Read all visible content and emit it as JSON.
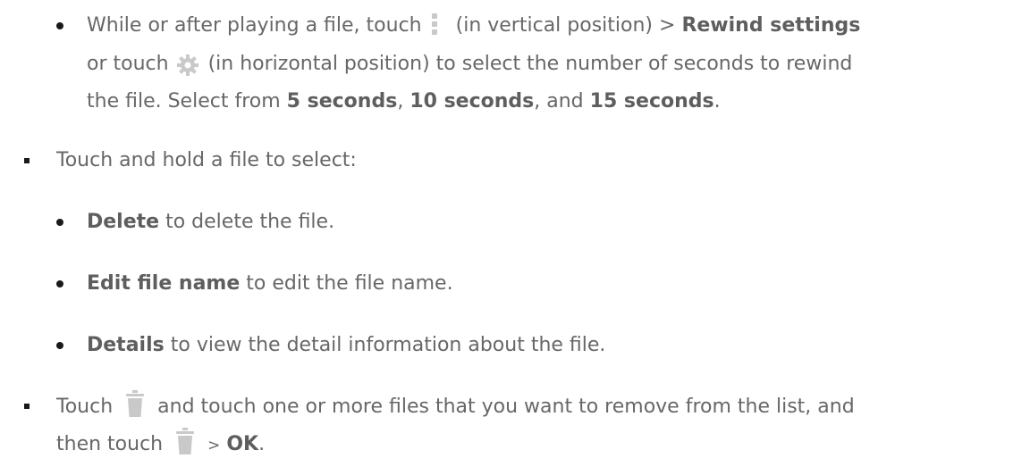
{
  "line1": {
    "pre": "While or after playing a file, touch",
    "mid": "(in vertical position) >",
    "bold": "Rewind settings"
  },
  "line2": {
    "pre": "or touch",
    "post": "(in horizontal position) to select the number of seconds to rewind"
  },
  "line3": {
    "pre": "the file. Select from",
    "opt1": "5 seconds",
    "sep1": ",",
    "opt2": "10 seconds",
    "sep2": ", and",
    "opt3": "15 seconds",
    "end": "."
  },
  "touch_hold": "Touch and hold a file to select:",
  "delete": {
    "bold": "Delete",
    "text": "to delete the file."
  },
  "edit": {
    "bold": "Edit file name",
    "text": "to edit the file name."
  },
  "details": {
    "bold": "Details",
    "text": "to view the detail information about the file."
  },
  "remove": {
    "pre": "Touch",
    "post": "and touch one or more files that you want to remove from the list, and",
    "line2_pre": "then touch",
    "line2_sep": ">",
    "ok": "OK",
    "end": "."
  },
  "icons": {
    "menu": "vertical-menu-icon",
    "gear": "gear-icon",
    "trash": "trash-icon"
  },
  "colors": {
    "text": "#676767",
    "icon": "#c9c9c9",
    "bullet": "#1a1a1a"
  }
}
